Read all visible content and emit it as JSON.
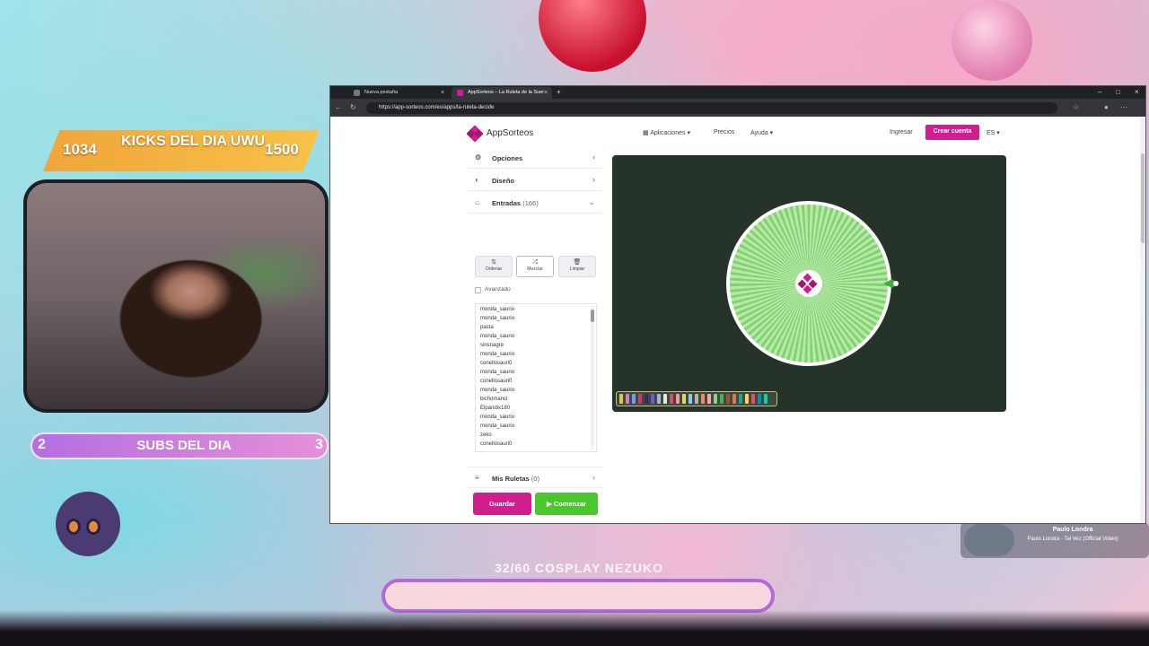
{
  "overlay": {
    "kicks": {
      "current": "1034",
      "title": "KICKS DEL DIA UWU",
      "goal": "1500"
    },
    "subs": {
      "current": "2",
      "title": "SUBS DEL DIA",
      "goal": "3"
    },
    "goal_text": "32/60 COSPLAY NEZUKO",
    "now_playing": {
      "artist": "Paulo Londra",
      "track": "Paulo Londra - Tal Vez (Official Video)"
    }
  },
  "browser": {
    "tabs": [
      {
        "label": "Nueva pestaña",
        "active": false
      },
      {
        "label": "AppSorteos – La Ruleta de la Suer",
        "active": true
      }
    ],
    "url": "https://app-sorteos.com/es/apps/la-ruleta-decide"
  },
  "site": {
    "logo": "AppSorteos",
    "nav": {
      "apps": "Aplicaciones",
      "prices": "Precios",
      "help": "Ayuda",
      "login": "Ingresar",
      "signup": "Crear cuenta",
      "lang": "ES"
    },
    "panel": {
      "options": "Opciones",
      "design": "Diseño",
      "entries": "Entradas",
      "entries_count": "(166)",
      "my_wheels": "Mis Ruletas",
      "my_wheels_count": "(0)",
      "sort": "Ordenar",
      "shuffle": "Mezclar",
      "clear": "Limpiar",
      "advanced": "Avanzado",
      "save": "Guardar",
      "start": "▶ Comenzar"
    },
    "entries": [
      "monda_saurio",
      "monda_saurio",
      "pasta",
      "monda_saurio",
      "sinsnagre",
      "monda_saurio",
      "conellosauri0",
      "monda_saurio",
      "conellosauri0",
      "monda_saurio",
      "bichomanci",
      "Elpandix180",
      "monda_saurio",
      "monda_saurio",
      "zeko",
      "conellosauri0"
    ],
    "wheel": {
      "segments": 166,
      "colors": [
        "#7fd36b",
        "#b7e7a9"
      ],
      "palette": [
        "#e8c14d",
        "#d97ac4",
        "#6aa0e0",
        "#c83b6e",
        "#3c2a4f",
        "#6f5bd6",
        "#a7b3d8",
        "#e6e6e6",
        "#d94d68",
        "#ff8fa3",
        "#f0d05e",
        "#8bc7e8",
        "#b3b3b3",
        "#f08a5d",
        "#ff9eb5",
        "#89d47b",
        "#4caf50",
        "#a0522d",
        "#e76f51",
        "#2a9d8f",
        "#ffd166",
        "#ef476f",
        "#118ab2",
        "#06d6a0"
      ]
    }
  }
}
